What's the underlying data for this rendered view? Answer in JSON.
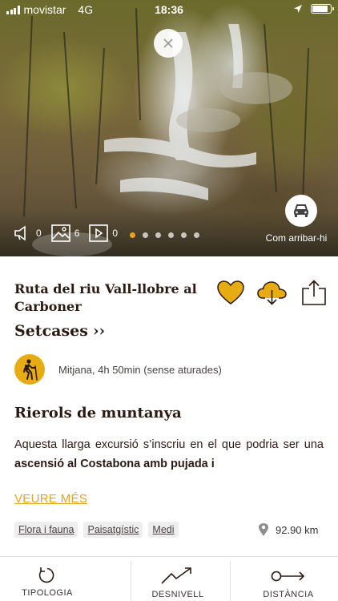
{
  "status_bar": {
    "carrier": "movistar",
    "network": "4G",
    "time": "18:36"
  },
  "hero": {
    "close_icon": "close-icon",
    "media": [
      {
        "icon": "audio-icon",
        "count": "0"
      },
      {
        "icon": "image-icon",
        "count": "6"
      },
      {
        "icon": "video-icon",
        "count": "0"
      }
    ],
    "carousel": {
      "total": 6,
      "active": 1
    },
    "directions_icon": "car-icon",
    "directions_label": "Com arribar-hi"
  },
  "route": {
    "title": "Ruta del riu Vall-llobre al Carboner",
    "town": "Setcases",
    "town_arrow": "››",
    "difficulty_icon": "hiker-icon",
    "difficulty_text": "Mitjana, 4h 50min (sense aturades)",
    "section_title": "Rierols de muntanya",
    "description_plain": "Aquesta llarga excursió s’inscriu en el que podria ser una ",
    "description_bold": "ascensió al Costabona amb pujada i",
    "more_label": "VEURE MÉS",
    "tags": [
      "Flora i fauna",
      "Paisatgístic",
      "Medi"
    ],
    "distance": "92.90 km"
  },
  "actions": {
    "favorite": "heart-icon",
    "download": "cloud-download-icon",
    "share": "share-icon"
  },
  "tabs": [
    {
      "label": "TIPOLOGIA",
      "icon": "refresh-icon"
    },
    {
      "label": "DESNIVELL",
      "icon": "elevation-icon"
    },
    {
      "label": "DISTÀNCIA",
      "icon": "distance-icon"
    }
  ],
  "colors": {
    "accent": "#E7AC12",
    "text": "#2B1A12"
  }
}
